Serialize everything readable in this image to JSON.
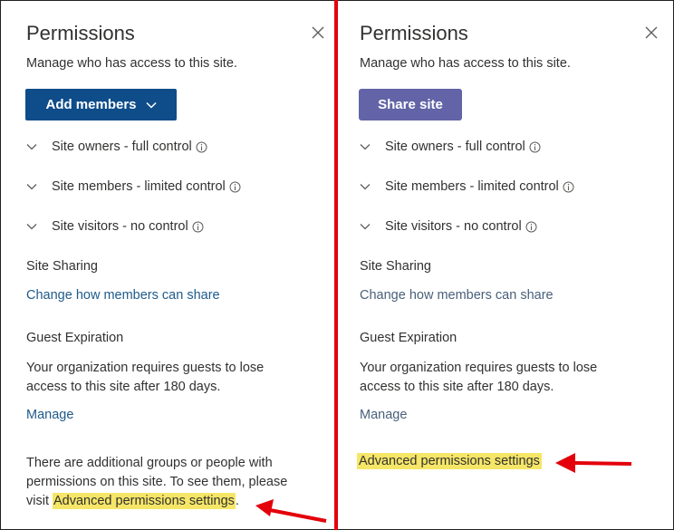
{
  "left_panel": {
    "title": "Permissions",
    "subtitle": "Manage who has access to this site.",
    "primary_button": "Add members",
    "groups": [
      {
        "label": "Site owners - full control"
      },
      {
        "label": "Site members - limited control"
      },
      {
        "label": "Site visitors - no control"
      }
    ],
    "site_sharing": {
      "heading": "Site Sharing",
      "link": "Change how members can share"
    },
    "guest_expiration": {
      "heading": "Guest Expiration",
      "line1": "Your organization requires guests to lose",
      "line2": "access to this site after 180 days.",
      "manage_link": "Manage"
    },
    "additional": {
      "line1": "There are additional groups or people with",
      "line2": "permissions on this site. To see them, please",
      "line3_prefix": "visit ",
      "link": "Advanced permissions settings",
      "suffix": "."
    }
  },
  "right_panel": {
    "title": "Permissions",
    "subtitle": "Manage who has access to this site.",
    "primary_button": "Share site",
    "groups": [
      {
        "label": "Site owners - full control"
      },
      {
        "label": "Site members - limited control"
      },
      {
        "label": "Site visitors - no control"
      }
    ],
    "site_sharing": {
      "heading": "Site Sharing",
      "link": "Change how members can share"
    },
    "guest_expiration": {
      "heading": "Guest Expiration",
      "line1": "Your organization requires guests to lose",
      "line2": "access to this site after 180 days.",
      "manage_link": "Manage"
    },
    "advanced_link": "Advanced permissions settings"
  },
  "colors": {
    "add_button": "#0f4c8a",
    "share_button": "#6264a7",
    "link": "#1e5a8a",
    "highlight": "#f6e667",
    "annotation_red": "#e3000b"
  }
}
